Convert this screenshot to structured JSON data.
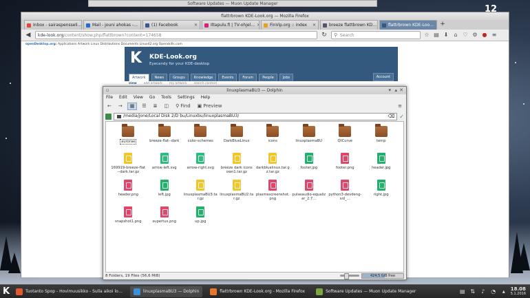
{
  "desktop": {
    "clock_overlay": "12"
  },
  "muon_window": {
    "title": "Software Updates — Muon Update Manager"
  },
  "firefox": {
    "title": "flattrbrown KDE-Look.org — Mozilla Firefox",
    "tabs": [
      {
        "label": "Inbox - sairaspensseli…",
        "color": "#d94b3b"
      },
      {
        "label": "Mail - jouni ahokas -…",
        "color": "#2a6bd1"
      },
      {
        "label": "(1) Facebook",
        "color": "#3b5998"
      },
      {
        "label": "Iltapulu.fi | TV-ohjel…",
        "color": "#d4237a"
      },
      {
        "label": "FinVip.org :: index",
        "color": "#e8a11a"
      },
      {
        "label": "breeze flattbrown KD…",
        "color": "#556"
      },
      {
        "label": "flattrbrown KDE-Loo…",
        "color": "#34597e",
        "active": true
      }
    ],
    "url_host": "kde-look.org",
    "url_path": "/content/show.php/flattbrown?content=174658",
    "search_placeholder": "Search",
    "page": {
      "od_bar_brand": "openDesktop.org:",
      "od_bar_links": "Applications   Artwork   Linux Distributions   Documents   Linux42.org   Openskills.com",
      "site_title": "KDE-Look.org",
      "site_subtitle": "Eyecandy for your KDE-desktop",
      "nav": [
        "Artwork",
        "News",
        "Groups",
        "Knowledge",
        "Events",
        "Forum",
        "People",
        "Jobs"
      ],
      "account": "Account",
      "subnav": [
        "view",
        "add artwork",
        "my artwork",
        "search content"
      ]
    }
  },
  "dolphin": {
    "title": "linuxplasmaBU3 — Dolphin",
    "menu": [
      "File",
      "Edit",
      "View",
      "Go",
      "Tools",
      "Settings",
      "Help"
    ],
    "toolbar": {
      "find": "Find",
      "preview": "Preview"
    },
    "location": "/media/jone/Local Disk 2/D bu/Linuxbu/linuxplasmaBU3/",
    "items": [
      {
        "name": "aurorae",
        "type": "folder",
        "selected": true
      },
      {
        "name": "breeze-flat--dark",
        "type": "folder"
      },
      {
        "name": "color-schemes",
        "type": "folder"
      },
      {
        "name": "DarkBlueLinux",
        "type": "folder"
      },
      {
        "name": "icons",
        "type": "folder"
      },
      {
        "name": "linuxplasmaBU",
        "type": "folder"
      },
      {
        "name": "QtCurve",
        "type": "folder"
      },
      {
        "name": "temp",
        "type": "folder"
      },
      {
        "name": "169919-breeze-flat--dark.tar.gz",
        "type": "archive"
      },
      {
        "name": "arrow-left.svg",
        "type": "svg"
      },
      {
        "name": "arrow-right.svg",
        "type": "svg"
      },
      {
        "name": "breeze dark icons own1.tar.gz",
        "type": "archive"
      },
      {
        "name": "darkbluelinux.tar.gz.tar.gz",
        "type": "archive"
      },
      {
        "name": "footer.jpg",
        "type": "img"
      },
      {
        "name": "footer.png",
        "type": "deb"
      },
      {
        "name": "header.jpg",
        "type": "img"
      },
      {
        "name": "header.png",
        "type": "deb"
      },
      {
        "name": "left.jpg",
        "type": "img"
      },
      {
        "name": "linuxplasmaBU3.tar.gz",
        "type": "archive"
      },
      {
        "name": "linuxplasmaBU2.tar.gz",
        "type": "archive"
      },
      {
        "name": "plasmascreenshot.png",
        "type": "deb"
      },
      {
        "name": "pulseaudio-equalizer_2.7…",
        "type": "deb"
      },
      {
        "name": "python3-devdeng-sid_…",
        "type": "deb"
      },
      {
        "name": "right.jpg",
        "type": "img"
      },
      {
        "name": "snapshot1.png",
        "type": "deb"
      },
      {
        "name": "supertux.png",
        "type": "deb"
      },
      {
        "name": "up.jpg",
        "type": "img"
      }
    ],
    "status": "8 Folders, 19 Files (56,6 MiB)",
    "free_space": "424,5 GiB free",
    "free_space_used_fraction": 0.55
  },
  "taskbar": {
    "tasks": [
      {
        "label": "Tuotanto Spop - Hovimuusikko - Sulla aikoi lo…",
        "color": "#e05a2a"
      },
      {
        "label": "linuxplasmaBU3 — Dolphin",
        "color": "#3d8fd6",
        "active": true
      },
      {
        "label": "flattrbrown KDE-Look.org - Mozilla Firefox",
        "color": "#e8772e"
      },
      {
        "label": "Software Updates — Muon Update Manager",
        "color": "#7aa640"
      }
    ],
    "time": "18.08",
    "date": "5.1.2016"
  }
}
